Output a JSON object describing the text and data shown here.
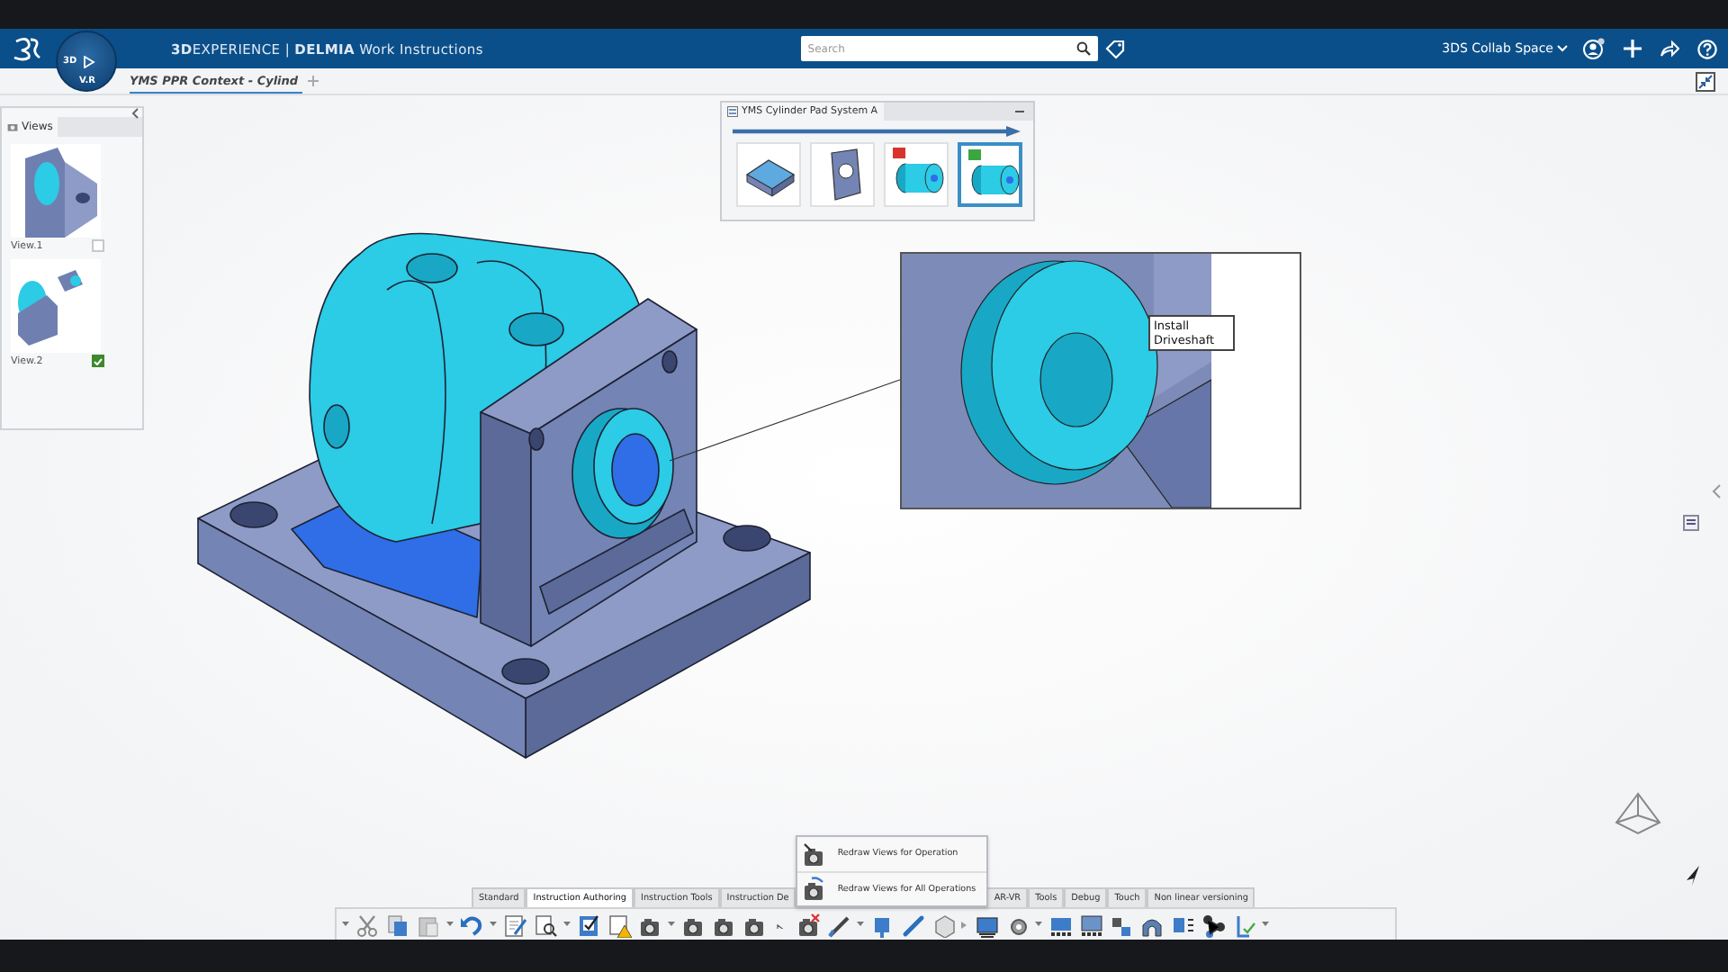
{
  "header": {
    "brand": "**3D**EXPERIENCE | **DELMIA** Work Instructions",
    "compass": {
      "left": "3D",
      "bottom": "V.R"
    },
    "search": {
      "placeholder": "Search"
    },
    "collab_space": "3DS Collab Space"
  },
  "tabs": [
    {
      "label": "YMS PPR Context - Cylind",
      "selected": true
    }
  ],
  "views_panel": {
    "tab": "Views",
    "views": [
      {
        "label": "View.1",
        "checked": false
      },
      {
        "label": "View.2",
        "checked": true
      }
    ]
  },
  "process_panel": {
    "title": "YMS Cylinder Pad System A",
    "steps": [
      {
        "kind": "plate",
        "selected": false
      },
      {
        "kind": "bracket",
        "selected": false
      },
      {
        "kind": "cylinder",
        "color": "#d9342b",
        "selected": false
      },
      {
        "kind": "cylinder",
        "color": "#3aa640",
        "selected": true
      }
    ]
  },
  "callout": {
    "label": "Install Driveshaft"
  },
  "popup_menu": [
    {
      "label": "Redraw Views for Operation"
    },
    {
      "label": "Redraw Views for All Operations"
    }
  ],
  "toolbar": {
    "tabs": [
      {
        "label": "Standard",
        "selected": false
      },
      {
        "label": "Instruction Authoring",
        "selected": true
      },
      {
        "label": "Instruction Tools",
        "selected": false
      },
      {
        "label": "Instruction De",
        "selected": false
      },
      {
        "label": "AR-VR",
        "selected": false
      },
      {
        "label": "Tools",
        "selected": false
      },
      {
        "label": "Debug",
        "selected": false
      },
      {
        "label": "Touch",
        "selected": false
      },
      {
        "label": "Non linear versioning",
        "selected": false
      }
    ]
  }
}
